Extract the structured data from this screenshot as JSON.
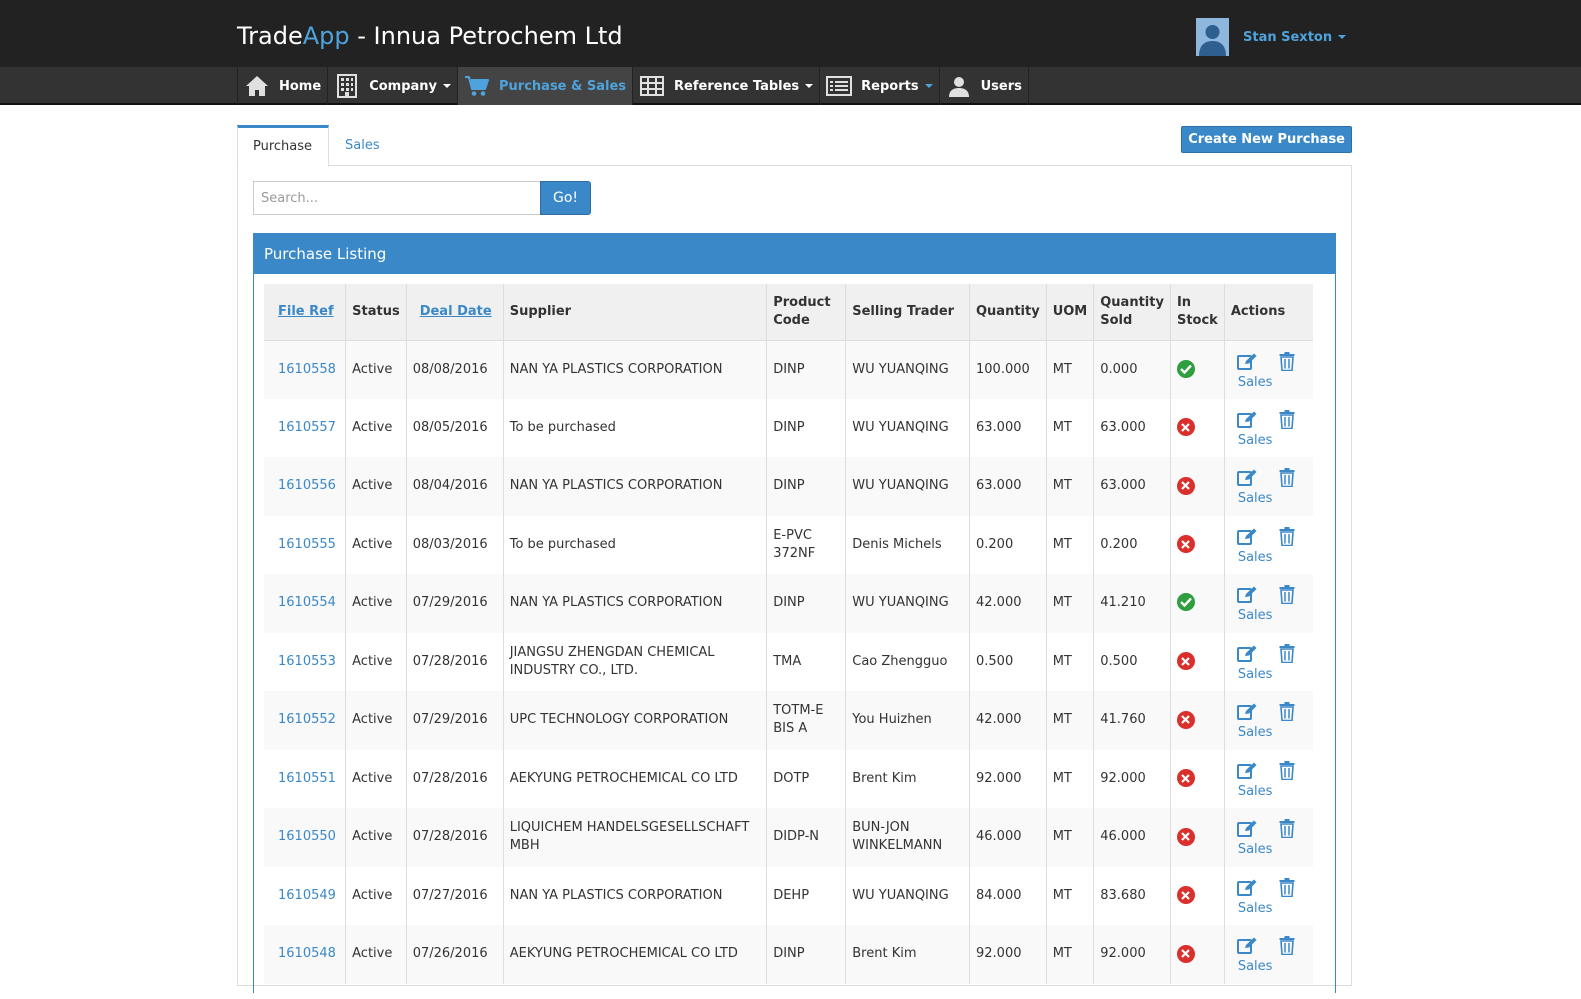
{
  "app": {
    "brand_primary": "Trade",
    "brand_accent": "App",
    "brand_suffix": " - Innua Petrochem Ltd",
    "user_name": "Stan Sexton"
  },
  "nav": {
    "home": "Home",
    "company": "Company",
    "purchase_sales": "Purchase & Sales",
    "reference_tables": "Reference Tables",
    "reports": "Reports",
    "users": "Users"
  },
  "tabs": {
    "purchase": "Purchase",
    "sales": "Sales"
  },
  "create_button": "Create New Purchase",
  "search": {
    "placeholder": "Search...",
    "go_label": "Go!"
  },
  "listing": {
    "title": "Purchase Listing",
    "columns": {
      "file_ref": "File Ref",
      "status": "Status",
      "deal_date": "Deal Date",
      "supplier": "Supplier",
      "product_code_1": "Product",
      "product_code_2": "Code",
      "selling_trader": "Selling Trader",
      "quantity": "Quantity",
      "uom": "UOM",
      "quantity_sold_1": "Quantity",
      "quantity_sold_2": "Sold",
      "in_stock_1": "In",
      "in_stock_2": "Stock",
      "actions": "Actions"
    },
    "action_sales_label": "Sales",
    "rows": [
      {
        "ref": "1610558",
        "status": "Active",
        "date": "08/08/2016",
        "supplier": "NAN YA PLASTICS CORPORATION",
        "product": "DINP",
        "trader": "WU YUANQING",
        "qty": "100.000",
        "uom": "MT",
        "sold": "0.000",
        "in_stock": true
      },
      {
        "ref": "1610557",
        "status": "Active",
        "date": "08/05/2016",
        "supplier": "To be purchased",
        "product": "DINP",
        "trader": "WU YUANQING",
        "qty": "63.000",
        "uom": "MT",
        "sold": "63.000",
        "in_stock": false
      },
      {
        "ref": "1610556",
        "status": "Active",
        "date": "08/04/2016",
        "supplier": "NAN YA PLASTICS CORPORATION",
        "product": "DINP",
        "trader": "WU YUANQING",
        "qty": "63.000",
        "uom": "MT",
        "sold": "63.000",
        "in_stock": false
      },
      {
        "ref": "1610555",
        "status": "Active",
        "date": "08/03/2016",
        "supplier": "To be purchased",
        "product": "E-PVC 372NF",
        "trader": "Denis Michels",
        "qty": "0.200",
        "uom": "MT",
        "sold": "0.200",
        "in_stock": false
      },
      {
        "ref": "1610554",
        "status": "Active",
        "date": "07/29/2016",
        "supplier": "NAN YA PLASTICS CORPORATION",
        "product": "DINP",
        "trader": "WU YUANQING",
        "qty": "42.000",
        "uom": "MT",
        "sold": "41.210",
        "in_stock": true
      },
      {
        "ref": "1610553",
        "status": "Active",
        "date": "07/28/2016",
        "supplier": "JIANGSU ZHENGDAN CHEMICAL INDUSTRY CO., LTD.",
        "product": "TMA",
        "trader": "Cao Zhengguo",
        "qty": "0.500",
        "uom": "MT",
        "sold": "0.500",
        "in_stock": false
      },
      {
        "ref": "1610552",
        "status": "Active",
        "date": "07/29/2016",
        "supplier": "UPC TECHNOLOGY CORPORATION",
        "product": "TOTM-E BIS A",
        "trader": "You Huizhen",
        "qty": "42.000",
        "uom": "MT",
        "sold": "41.760",
        "in_stock": false
      },
      {
        "ref": "1610551",
        "status": "Active",
        "date": "07/28/2016",
        "supplier": "AEKYUNG PETROCHEMICAL CO LTD",
        "product": "DOTP",
        "trader": "Brent Kim",
        "qty": "92.000",
        "uom": "MT",
        "sold": "92.000",
        "in_stock": false
      },
      {
        "ref": "1610550",
        "status": "Active",
        "date": "07/28/2016",
        "supplier": "LIQUICHEM HANDELSGESELLSCHAFT MBH",
        "product": "DIDP-N",
        "trader": "BUN-JON WINKELMANN",
        "qty": "46.000",
        "uom": "MT",
        "sold": "46.000",
        "in_stock": false
      },
      {
        "ref": "1610549",
        "status": "Active",
        "date": "07/27/2016",
        "supplier": "NAN YA PLASTICS CORPORATION",
        "product": "DEHP",
        "trader": "WU YUANQING",
        "qty": "84.000",
        "uom": "MT",
        "sold": "83.680",
        "in_stock": false
      },
      {
        "ref": "1610548",
        "status": "Active",
        "date": "07/26/2016",
        "supplier": "AEKYUNG PETROCHEMICAL CO LTD",
        "product": "DINP",
        "trader": "Brent Kim",
        "qty": "92.000",
        "uom": "MT",
        "sold": "92.000",
        "in_stock": false
      }
    ]
  },
  "colors": {
    "accent": "#3b88c8",
    "topbar": "#222222",
    "navbar": "#333333",
    "in_stock": "#2e9e3e",
    "out_of_stock": "#d9302c"
  }
}
